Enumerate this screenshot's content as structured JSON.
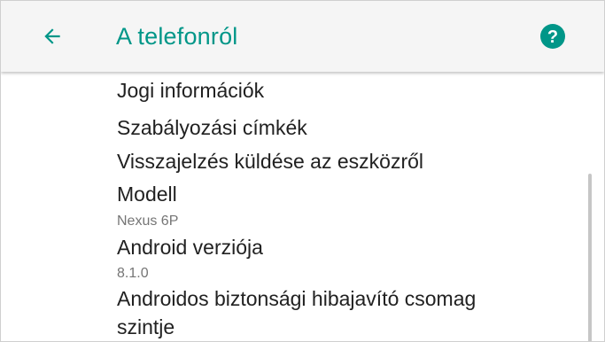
{
  "toolbar": {
    "title": "A telefonról",
    "back_icon": "arrow-left-icon",
    "help_icon": "help-circle-icon"
  },
  "list": {
    "legal": "Jogi információk",
    "regulatory": "Szabályozási címkék",
    "feedback": "Visszajelzés küldése az eszközről",
    "model_label": "Modell",
    "model_value": "Nexus 6P",
    "android_label": "Android verziója",
    "android_value": "8.1.0",
    "patch_line1": "Androidos biztonsági hibajavító csomag",
    "patch_line2": "szintje"
  },
  "colors": {
    "accent": "#009688",
    "toolbar_bg": "#f5f5f5",
    "primary_text": "#212121",
    "secondary_text": "#757575"
  }
}
